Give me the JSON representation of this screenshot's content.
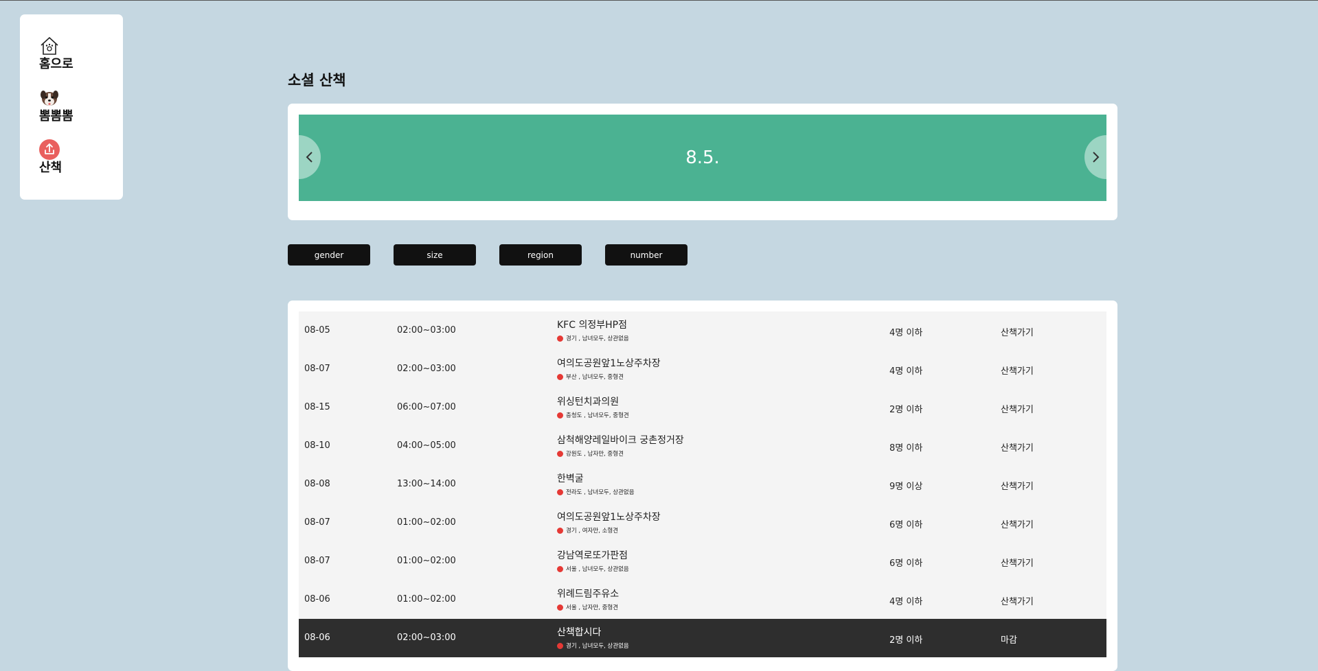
{
  "sidebar": {
    "items": [
      {
        "label": "홈으로",
        "icon": "home-paw-icon"
      },
      {
        "label": "뽐뽐뽐",
        "icon": "dog-face-icon"
      },
      {
        "label": "산책",
        "icon": "upload-icon"
      }
    ]
  },
  "page": {
    "title": "소셜 산책"
  },
  "banner": {
    "text": "8.5.",
    "color": "#4bb292"
  },
  "filters": [
    "gender",
    "size",
    "region",
    "number"
  ],
  "walks": [
    {
      "date": "08-05",
      "time": "02:00~03:00",
      "place": "KFC 의정부HP점",
      "tags": "경기 , 남녀모두, 상관없음",
      "count": "4명 이하",
      "action": "산책가기",
      "closed": false
    },
    {
      "date": "08-07",
      "time": "02:00~03:00",
      "place": "여의도공원앞1노상주차장",
      "tags": "부산 , 남녀모두, 중형견",
      "count": "4명 이하",
      "action": "산책가기",
      "closed": false
    },
    {
      "date": "08-15",
      "time": "06:00~07:00",
      "place": "위싱턴치과의원",
      "tags": "충청도 , 남녀모두, 중형견",
      "count": "2명 이하",
      "action": "산책가기",
      "closed": false
    },
    {
      "date": "08-10",
      "time": "04:00~05:00",
      "place": "삼척해양레일바이크 궁촌정거장",
      "tags": "강원도 , 남자만, 중형견",
      "count": "8명 이하",
      "action": "산책가기",
      "closed": false
    },
    {
      "date": "08-08",
      "time": "13:00~14:00",
      "place": "한벽굴",
      "tags": "전라도 , 남녀모두, 상관없음",
      "count": "9명 이상",
      "action": "산책가기",
      "closed": false
    },
    {
      "date": "08-07",
      "time": "01:00~02:00",
      "place": "여의도공원앞1노상주차장",
      "tags": "경기 , 여자만, 소형견",
      "count": "6명 이하",
      "action": "산책가기",
      "closed": false
    },
    {
      "date": "08-07",
      "time": "01:00~02:00",
      "place": "강남역로또가판점",
      "tags": "서울 , 남녀모두, 상관없음",
      "count": "6명 이하",
      "action": "산책가기",
      "closed": false
    },
    {
      "date": "08-06",
      "time": "01:00~02:00",
      "place": "위례드림주유소",
      "tags": "서울 , 남자만, 중형견",
      "count": "4명 이하",
      "action": "산책가기",
      "closed": false
    },
    {
      "date": "08-06",
      "time": "02:00~03:00",
      "place": "산책합시다",
      "tags": "경기 , 남녀모두, 상관없음",
      "count": "2명 이하",
      "action": "마감",
      "closed": true
    }
  ]
}
